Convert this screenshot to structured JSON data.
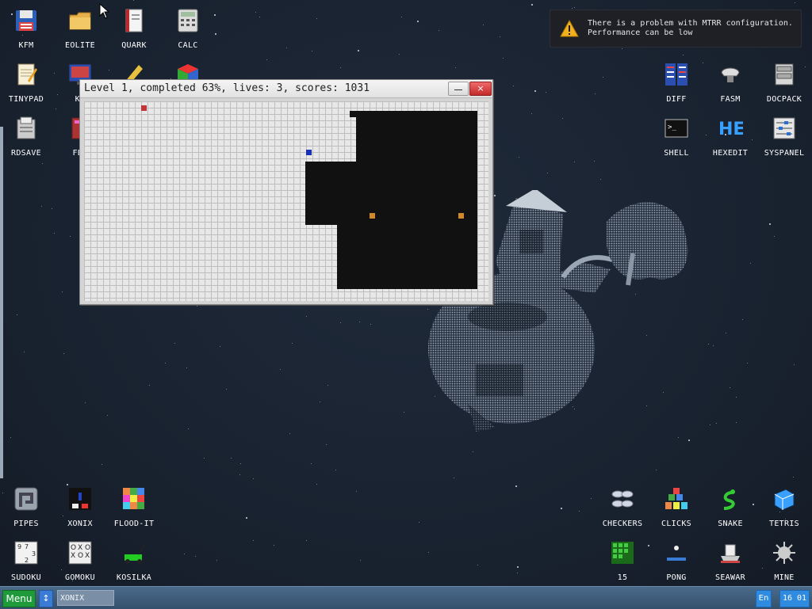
{
  "notification": {
    "text": "There is a problem with MTRR configuration.\nPerformance can be low",
    "icon": "warning-icon"
  },
  "game_window": {
    "title": "Level 1, completed 63%, lives: 3, scores: 1031",
    "level": 1,
    "completed_percent": 63,
    "lives": 3,
    "scores": 1031,
    "minimize_label": "",
    "close_label": "×"
  },
  "desktop_icons_left": [
    {
      "label": "KFM",
      "icon": "floppy-disk-icon"
    },
    {
      "label": "EOLITE",
      "icon": "folder-icon"
    },
    {
      "label": "QUARK",
      "icon": "notebook-icon"
    },
    {
      "label": "CALC",
      "icon": "calculator-icon"
    },
    {
      "label": "TINYPAD",
      "icon": "notepad-icon"
    },
    {
      "label": "KF",
      "icon": "monitor-icon"
    },
    {
      "label": "",
      "icon": "pencil-icon"
    },
    {
      "label": "",
      "icon": "cube-icon"
    },
    {
      "label": "RDSAVE",
      "icon": "save-icon"
    },
    {
      "label": "FB2",
      "icon": "book-icon"
    }
  ],
  "desktop_icons_right": [
    {
      "label": "DIFF",
      "icon": "diff-icon"
    },
    {
      "label": "FASM",
      "icon": "fasm-icon"
    },
    {
      "label": "DOCPACK",
      "icon": "docpack-icon"
    },
    {
      "label": "SHELL",
      "icon": "terminal-icon"
    },
    {
      "label": "HEXEDIT",
      "icon": "hexedit-icon"
    },
    {
      "label": "SYSPANEL",
      "icon": "sliders-icon"
    }
  ],
  "desktop_icons_games_left": [
    {
      "label": "PIPES",
      "icon": "pipes-icon"
    },
    {
      "label": "XONIX",
      "icon": "xonix-icon"
    },
    {
      "label": "FLOOD-IT",
      "icon": "flood-it-icon"
    },
    {
      "label": "SUDOKU",
      "icon": "sudoku-icon"
    },
    {
      "label": "GOMOKU",
      "icon": "gomoku-icon"
    },
    {
      "label": "KOSILKA",
      "icon": "lawnmower-icon"
    }
  ],
  "desktop_icons_games_right": [
    {
      "label": "CHECKERS",
      "icon": "checkers-icon"
    },
    {
      "label": "CLICKS",
      "icon": "clicks-icon"
    },
    {
      "label": "SNAKE",
      "icon": "snake-icon"
    },
    {
      "label": "TETRIS",
      "icon": "tetris-icon"
    },
    {
      "label": "15",
      "icon": "fifteen-icon"
    },
    {
      "label": "PONG",
      "icon": "pong-icon"
    },
    {
      "label": "SEAWAR",
      "icon": "seawar-icon"
    },
    {
      "label": "MINE",
      "icon": "mine-icon"
    }
  ],
  "taskbar": {
    "menu_label": "Menu",
    "arrow_label": "↕",
    "task_label": "XONIX",
    "lang_label": "En",
    "clock": "16 01"
  },
  "colors": {
    "desktop": "#1b2534",
    "enemy_red": "#c0343a",
    "player_blue": "#1830b8",
    "ball_orange": "#d08a2a",
    "filled": "#111111"
  }
}
